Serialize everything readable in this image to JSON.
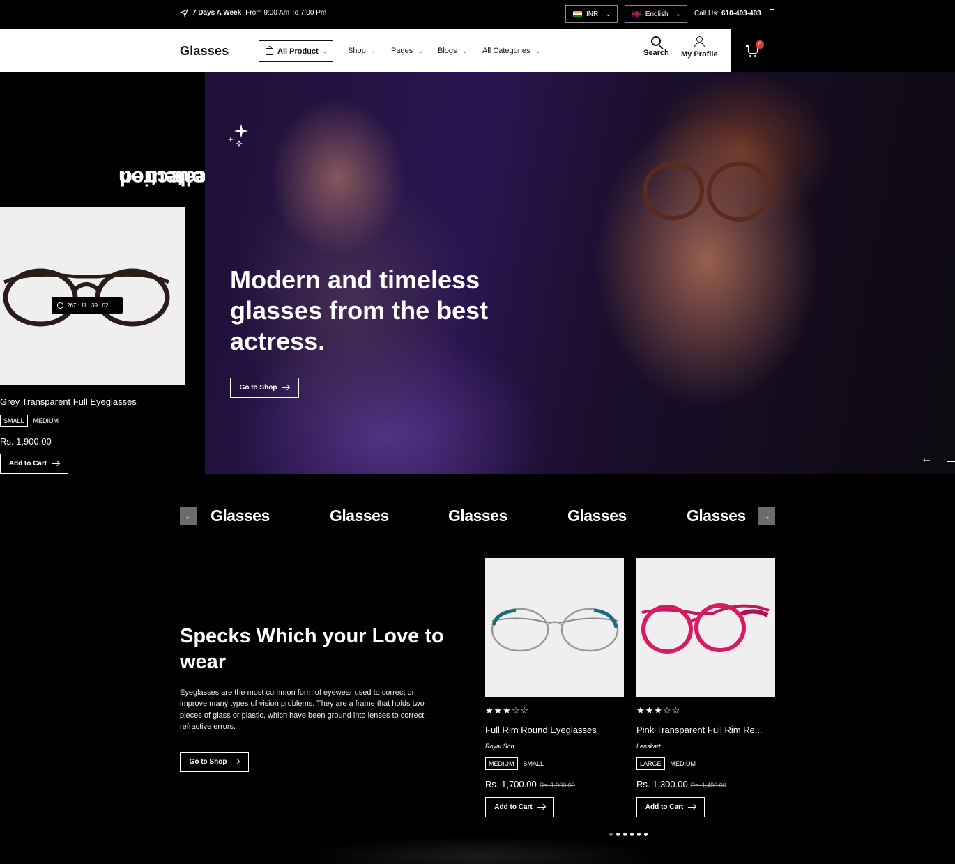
{
  "topbar": {
    "hours_bold": "7 Days A Week",
    "hours_text": "From 9:00 Am To 7:00 Pm",
    "currency": "INR",
    "language": "English",
    "call_label": "Call Us:",
    "call_number": "610-403-403"
  },
  "nav": {
    "logo": "Glasses",
    "all_product": "All Product",
    "menu": [
      "Shop",
      "Pages",
      "Blogs",
      "All Categories"
    ],
    "search": "Search",
    "profile": "My Profile",
    "cart_count": "0"
  },
  "featured": {
    "title_line1": "Feateured",
    "title_line2": "Collection",
    "timer": "267 : 11 : 39 : 02",
    "product_name": "Grey Transparent Full Eyeglasses",
    "sizes": [
      "SMALL",
      "MEDIUM"
    ],
    "price": "Rs. 1,900.00",
    "add_to_cart": "Add to Cart"
  },
  "hero": {
    "heading": "Modern and timeless glasses from the best actress.",
    "cta": "Go to Shop"
  },
  "brands": [
    "Glasses",
    "Glasses",
    "Glasses",
    "Glasses",
    "Glasses"
  ],
  "specks": {
    "title": "Specks Which your Love to wear",
    "description": "Eyeglasses are the most common form of eyewear used to correct or improve many types of vision problems. They are a frame that holds two pieces of glass or plastic, which have been ground into lenses to correct refractive errors.",
    "cta": "Go to Shop"
  },
  "products": [
    {
      "name": "Full Rim Round Eyeglasses",
      "brand": "Royal Son",
      "stars": "★★★☆☆",
      "rating": 3,
      "sizes": [
        "MEDIUM",
        "SMALL"
      ],
      "price": "Rs. 1,700.00",
      "old_price": "Rs. 1,900.00",
      "add_to_cart": "Add to Cart"
    },
    {
      "name": "Pink Transparent Full Rim Re...",
      "brand": "Lenskart",
      "stars": "★★★☆☆",
      "rating": 3,
      "sizes": [
        "LARGE",
        "MEDIUM"
      ],
      "price": "Rs. 1,300.00",
      "old_price": "Rs. 1,400.00",
      "add_to_cart": "Add to Cart"
    }
  ],
  "colors": {
    "background": "#000000",
    "nav_bg": "#ffffff",
    "badge": "#e53935",
    "card_bg": "#efefef"
  }
}
